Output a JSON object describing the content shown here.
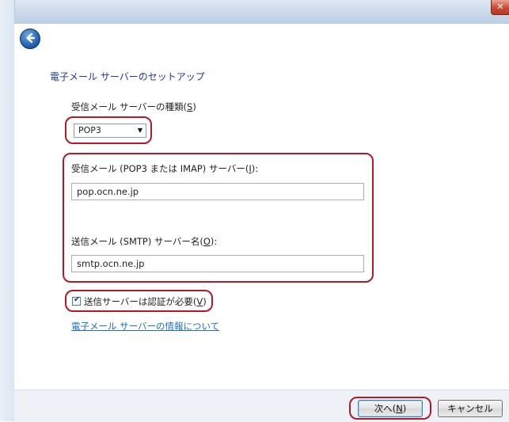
{
  "window": {
    "close_label": "✕"
  },
  "wizard": {
    "title": "電子メール サーバーのセットアップ",
    "incoming_type_label": "受信メール サーバーの種類",
    "incoming_type_accesskey": "S",
    "incoming_type_value": "POP3",
    "incoming_server_label": "受信メール (POP3 または IMAP) サーバー",
    "incoming_server_accesskey": "I",
    "incoming_server_value": "pop.ocn.ne.jp",
    "outgoing_server_label": "送信メール (SMTP) サーバー名",
    "outgoing_server_accesskey": "O",
    "outgoing_server_value": "smtp.ocn.ne.jp",
    "auth_required_label": "送信サーバーは認証が必要",
    "auth_required_accesskey": "V",
    "auth_required_checked": true,
    "info_link": "電子メール サーバーの情報について"
  },
  "footer": {
    "next_label": "次へ",
    "next_accesskey": "N",
    "cancel_label": "キャンセル"
  },
  "colors": {
    "highlight_box": "#b21a2a",
    "title_text": "#1b3d8a",
    "link_text": "#1f6fc2"
  }
}
